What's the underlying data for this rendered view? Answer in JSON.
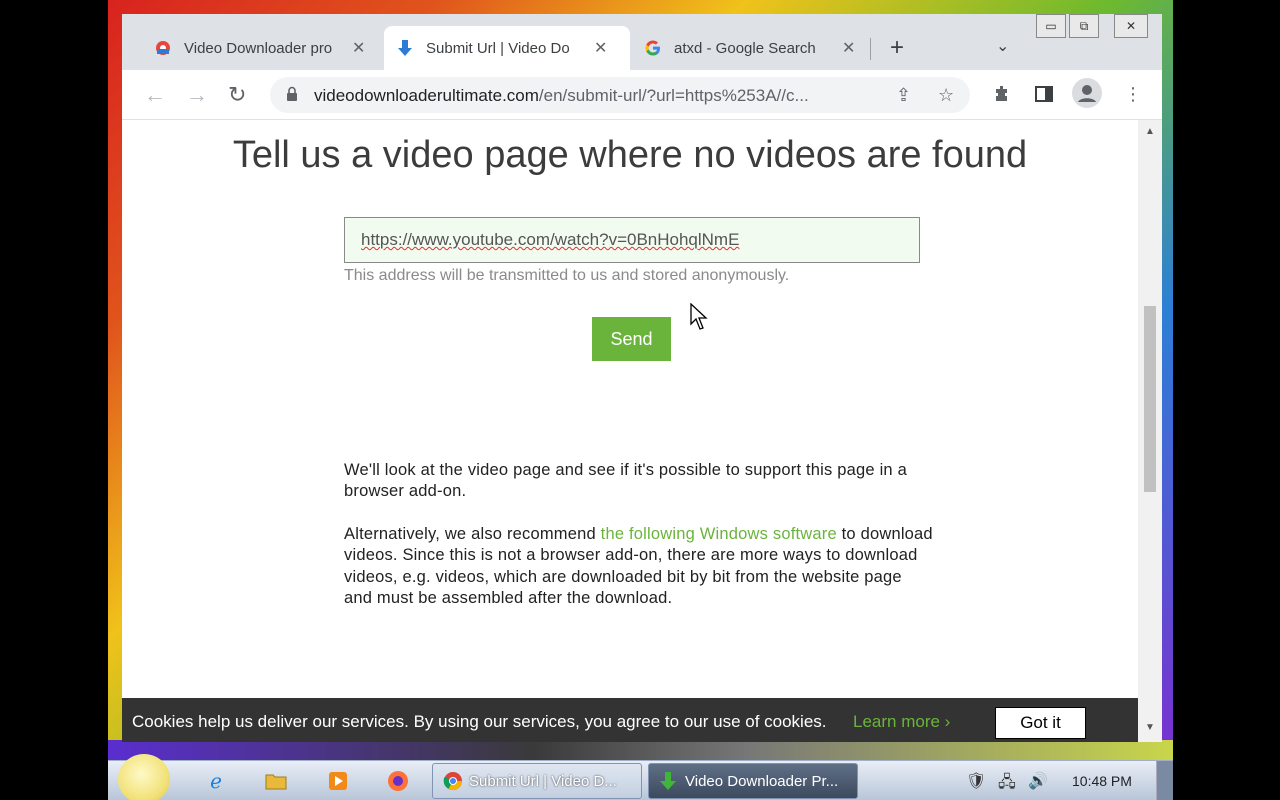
{
  "window_controls": {
    "minimize": "▭",
    "restore": "⧉",
    "close": "✕"
  },
  "tabs": [
    {
      "title": "Video Downloader pro",
      "close": "✕"
    },
    {
      "title": "Submit Url | Video Do",
      "close": "✕"
    },
    {
      "title": "atxd - Google Search",
      "close": "✕"
    }
  ],
  "new_tab_label": "+",
  "tab_search_label": "⌄",
  "address": {
    "domain": "videodownloaderultimate.com",
    "path": "/en/submit-url/?url=https%253A//c..."
  },
  "page": {
    "headline": "Tell us a video page where no videos are found",
    "input_value": "https://www.youtube.com/watch?v=0BnHohqlNmE",
    "hint": "This address will be transmitted to us and stored anonymously.",
    "send_label": "Send",
    "para1": "We'll look at the video page and see if it's possible to support this page in a browser add-on.",
    "para2_before": "Alternatively, we also recommend ",
    "para2_link": "the following Windows software",
    "para2_after": " to download videos. Since this is not a browser add-on, there are more ways to download videos, e.g. videos, which are downloaded bit by bit from the website page and must be assembled after the download."
  },
  "cookie": {
    "text": "Cookies help us deliver our services. By using our services, you agree to our use of cookies.",
    "learn_more": "Learn more ›",
    "got_it": "Got it"
  },
  "taskbar": {
    "buttons": [
      {
        "label": "Submit Url | Video D..."
      },
      {
        "label": "Video Downloader Pr..."
      }
    ],
    "clock": "10:48 PM"
  },
  "colors": {
    "accent_green": "#6bb43c",
    "cookie_bg": "#333333"
  }
}
